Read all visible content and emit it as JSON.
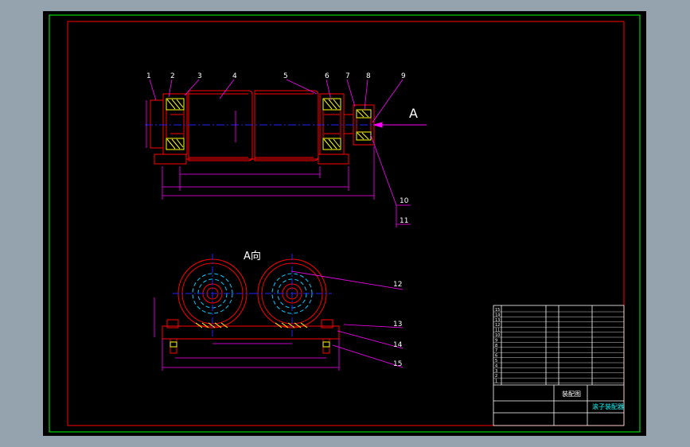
{
  "drawing": {
    "view_label": "A",
    "view_direction_label": "A向",
    "top_part_numbers": [
      "1",
      "2",
      "3",
      "4",
      "5",
      "6",
      "7",
      "8",
      "9"
    ],
    "right_part_numbers": [
      "10",
      "11"
    ],
    "side_part_numbers": [
      "12",
      "13",
      "14",
      "15"
    ],
    "colors": {
      "background": "#000000",
      "outer_border": "#00ff00",
      "inner_border": "#ff0000",
      "outline": "#ff0000",
      "centerline": "#2222ff",
      "dimension": "#ff00ff",
      "hatch": "#ffff00",
      "leader": "#ff00ff",
      "title_text": "#00ffff",
      "window_background": "#94a3ad"
    }
  },
  "title_block": {
    "part_label": "装配图",
    "drawing_name": "滚子装配器",
    "row_numbers": [
      "15",
      "14",
      "13",
      "12",
      "11",
      "10",
      "9",
      "8",
      "7",
      "6",
      "5",
      "4",
      "3",
      "2",
      "1"
    ]
  }
}
